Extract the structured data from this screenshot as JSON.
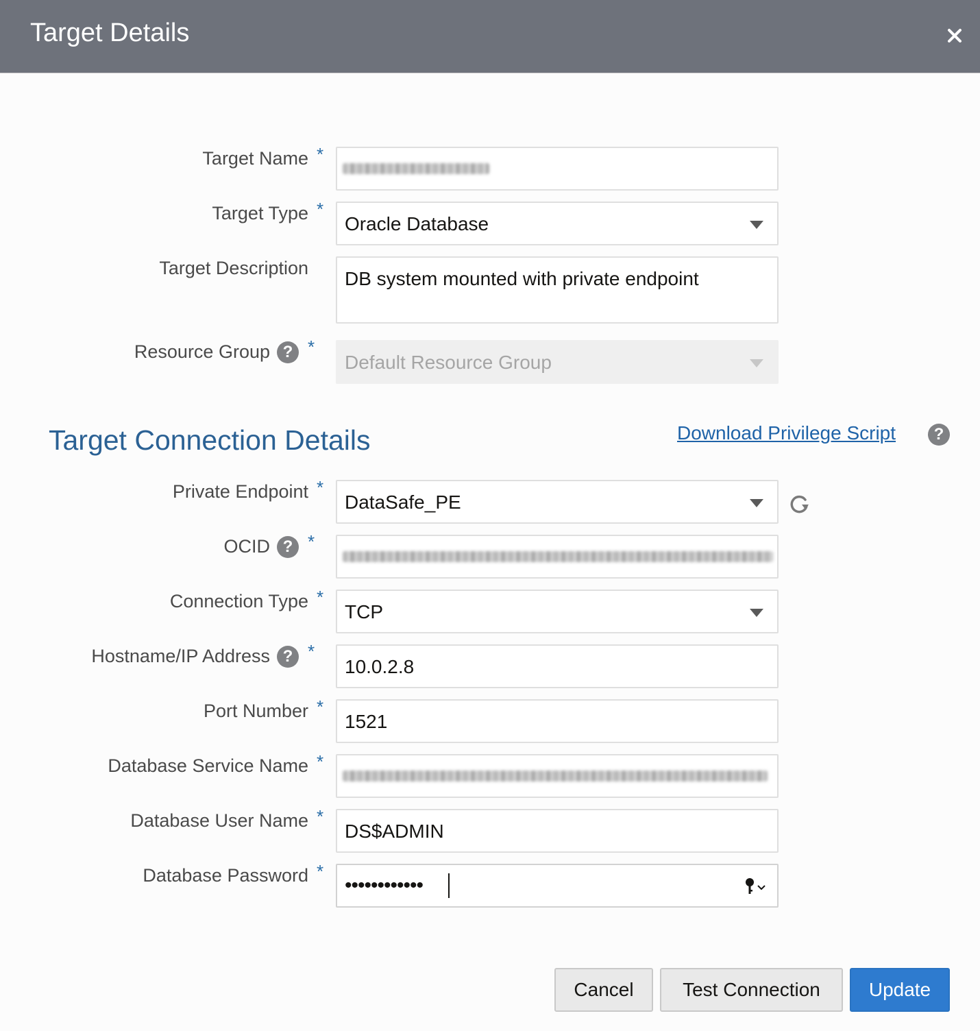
{
  "dialog": {
    "title": "Target Details",
    "close_icon": "close-icon"
  },
  "form": {
    "target_name": {
      "label": "Target Name",
      "required": "*",
      "value_obscured": true
    },
    "target_type": {
      "label": "Target Type",
      "required": "*",
      "value": "Oracle Database"
    },
    "target_description": {
      "label": "Target Description",
      "value": "DB system mounted with private endpoint"
    },
    "resource_group": {
      "label": "Resource Group",
      "required": "*",
      "help": "?",
      "value": "Default Resource Group",
      "disabled": true
    }
  },
  "connection": {
    "section_title": "Target Connection Details",
    "download_link": "Download Privilege Script",
    "help": "?",
    "private_endpoint": {
      "label": "Private Endpoint",
      "required": "*",
      "value": "DataSafe_PE",
      "refresh_icon": "refresh-icon"
    },
    "ocid": {
      "label": "OCID",
      "required": "*",
      "help": "?",
      "value_obscured": true
    },
    "connection_type": {
      "label": "Connection Type",
      "required": "*",
      "value": "TCP"
    },
    "hostname": {
      "label": "Hostname/IP Address",
      "required": "*",
      "help": "?",
      "value": "10.0.2.8"
    },
    "port": {
      "label": "Port Number",
      "required": "*",
      "value": "1521"
    },
    "service_name": {
      "label": "Database Service Name",
      "required": "*",
      "value_obscured": true
    },
    "user_name": {
      "label": "Database User Name",
      "required": "*",
      "value": "DS$ADMIN"
    },
    "password": {
      "label": "Database Password",
      "required": "*",
      "masked_value": "••••••••••••",
      "key_icon": "key-icon"
    }
  },
  "buttons": {
    "cancel": "Cancel",
    "test_connection": "Test Connection",
    "update": "Update"
  },
  "colors": {
    "titlebar": "#6e727b",
    "accent_blue": "#2b6194",
    "primary_button": "#2e7bcf",
    "required_star": "#2b6ea8"
  }
}
